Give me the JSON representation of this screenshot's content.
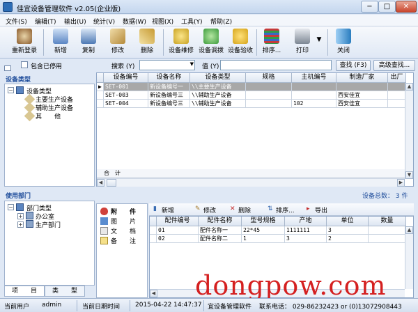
{
  "window": {
    "title": "佳宜设备管理软件 v2.05(企业版)",
    "min": "−",
    "max": "□",
    "close": "✕"
  },
  "menu": [
    "文件(S)",
    "编辑(T)",
    "输出(U)",
    "统计(V)",
    "数据(W)",
    "视图(X)",
    "工具(Y)",
    "帮助(Z)"
  ],
  "toolbar": [
    {
      "label": "重新登录",
      "icon": "relogin-icon",
      "color": "#8a5a2b"
    },
    {
      "label": "新增",
      "icon": "new-icon",
      "color": "#5b86c4"
    },
    {
      "label": "复制",
      "icon": "copy-icon",
      "color": "#4e7ab5"
    },
    {
      "label": "修改",
      "icon": "edit-icon",
      "color": "#b58a3a"
    },
    {
      "label": "删除",
      "icon": "delete-icon",
      "color": "#c79a32"
    },
    {
      "label": "设备维修",
      "icon": "repair-icon",
      "color": "#c9a324"
    },
    {
      "label": "设备调拨",
      "icon": "transfer-icon",
      "color": "#3d9c3d"
    },
    {
      "label": "设备验收",
      "icon": "accept-icon",
      "color": "#d6a51c"
    },
    {
      "label": "排序...",
      "icon": "sort-icon",
      "color": "#2f9b4a"
    },
    {
      "label": "打印",
      "icon": "print-icon",
      "color": "#7d8794"
    },
    {
      "label": "关闭",
      "icon": "close-app-icon",
      "color": "#2a7dbf"
    }
  ],
  "filter": {
    "include_disabled": "包含已停用",
    "search_label": "搜索 (Y)",
    "search_value": "",
    "value_label": "值 (Y)",
    "value_text": "",
    "find_button": "查找 (F3)",
    "advanced_button": "高级查找..."
  },
  "equipment_panel": {
    "title": "设备类型",
    "tree": {
      "root": "设备类型",
      "children": [
        "主要生产设备",
        "辅助生产设备",
        "其　　他"
      ]
    }
  },
  "equipment_grid": {
    "columns": [
      "设备编号",
      "设备名称",
      "设备类型",
      "规格",
      "主机编号",
      "制造厂家",
      "出厂"
    ],
    "rows": [
      [
        "SET-001",
        "新设备编号一",
        "\\\\主要生产设备",
        "",
        "",
        "",
        ""
      ],
      [
        "SET-003",
        "新设备编号三",
        "\\\\辅助生产设备",
        "",
        "",
        "西安佳宜",
        ""
      ],
      [
        "SET-004",
        "新设备编号三",
        "\\\\辅助生产设备",
        "",
        "102",
        "西安佳宜",
        ""
      ]
    ],
    "footer_label": "合　计"
  },
  "dept_panel": {
    "title": "使用部门",
    "tree": {
      "root": "部门类型",
      "children": [
        "办公室",
        "生产部门"
      ]
    },
    "total": "设备总数：  3 件"
  },
  "side_list": [
    {
      "label": "附　　件",
      "icon": "attachment-icon"
    },
    {
      "label": "图　　片",
      "icon": "picture-icon"
    },
    {
      "label": "文　　档",
      "icon": "document-icon"
    },
    {
      "label": "备　　注",
      "icon": "note-icon"
    }
  ],
  "sub_toolbar": [
    "新增",
    "修改",
    "删除",
    "排序...",
    "导出"
  ],
  "parts_grid": {
    "columns": [
      "配件编号",
      "配件名称",
      "型号规格",
      "产地",
      "单位",
      "数量"
    ],
    "rows": [
      [
        "01",
        "配件名称一",
        "22*45",
        "1111111",
        "3",
        ""
      ],
      [
        "02",
        "配件名称二",
        "1",
        "3",
        "2",
        ""
      ]
    ]
  },
  "bottom_tabs": [
    "项　　目",
    "类　　型"
  ],
  "status": {
    "user_label": "当前用户",
    "user": "admin",
    "date_label": "当前日期时间",
    "datetime": "2015-04-22 14:47:37",
    "app": "宜设备管理软件",
    "phone": "联系电话： 029-86232423 or (0)13072908443"
  },
  "watermark": "dongpow.com"
}
